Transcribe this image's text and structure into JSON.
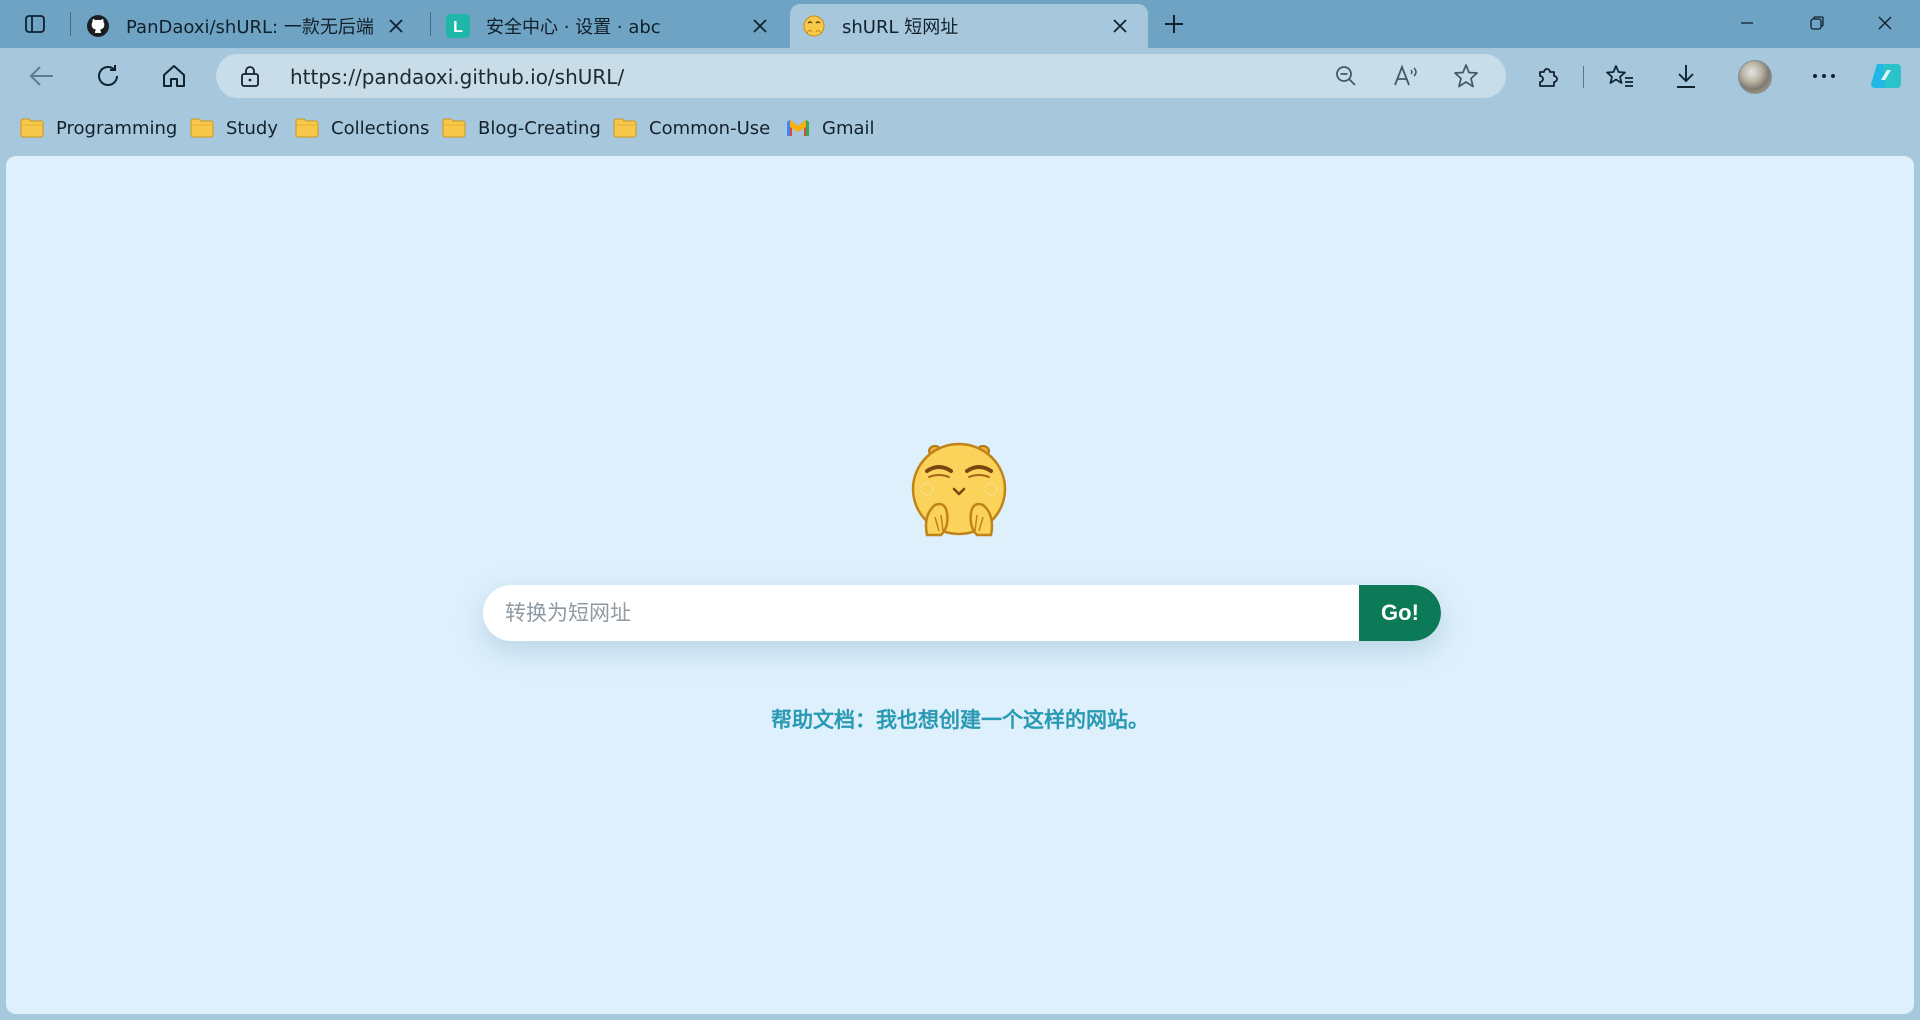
{
  "browser": {
    "tabs": [
      {
        "title": "PanDaoxi/shURL: 一款无后端的",
        "favicon": "github-icon",
        "active": false
      },
      {
        "title": "安全中心 · 设置 · abc",
        "favicon": "L",
        "active": false
      },
      {
        "title": "shURL 短网址",
        "favicon": "emoji-mascot-icon",
        "active": true
      }
    ],
    "address_bar": {
      "url": "https://pandaoxi.github.io/shURL/"
    },
    "favorites": [
      {
        "label": "Programming",
        "icon": "folder-icon"
      },
      {
        "label": "Study",
        "icon": "folder-icon"
      },
      {
        "label": "Collections",
        "icon": "folder-icon"
      },
      {
        "label": "Blog-Creating",
        "icon": "folder-icon"
      },
      {
        "label": "Common-Use",
        "icon": "folder-icon"
      },
      {
        "label": "Gmail",
        "icon": "gmail-icon"
      }
    ],
    "colors": {
      "tabstrip": "#6fa3c3",
      "toolbar": "#a7c8dc",
      "page_bg": "#def0fc",
      "go_button": "#0c7a57",
      "help_link": "#2a9ab4"
    }
  },
  "page": {
    "search": {
      "placeholder": "转换为短网址",
      "value": "",
      "button_label": "Go!"
    },
    "help_link": "帮助文档：我也想创建一个这样的网站。"
  }
}
